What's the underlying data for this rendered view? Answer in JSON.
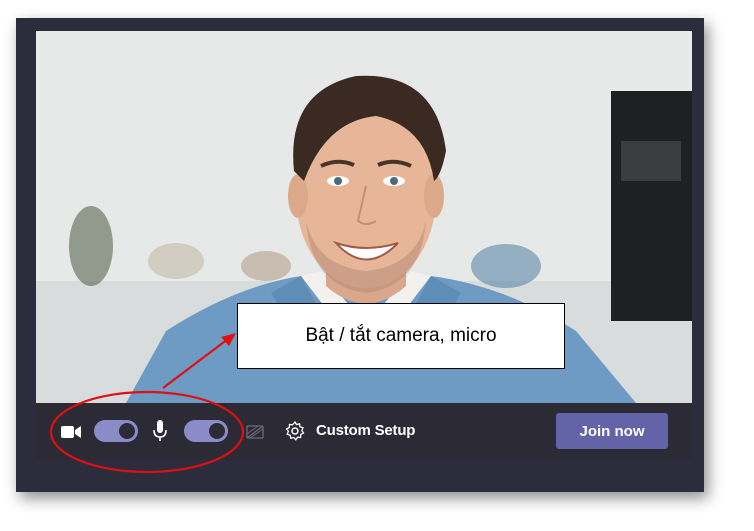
{
  "toolbar": {
    "camera_icon": "video-camera-icon",
    "camera_toggle_on": true,
    "mic_icon": "microphone-icon",
    "mic_toggle_on": true,
    "background_icon": "background-effects-icon",
    "settings_icon": "gear-icon",
    "custom_setup_label": "Custom Setup",
    "join_label": "Join now"
  },
  "annotation": {
    "callout_text": "Bật / tắt camera, micro"
  },
  "colors": {
    "frame_bg": "#2d2c3c",
    "toolbar_bg": "#2b2a35",
    "toggle_on": "#8b8cc7",
    "join_button": "#6264a7",
    "annotation_red": "#e01010"
  }
}
